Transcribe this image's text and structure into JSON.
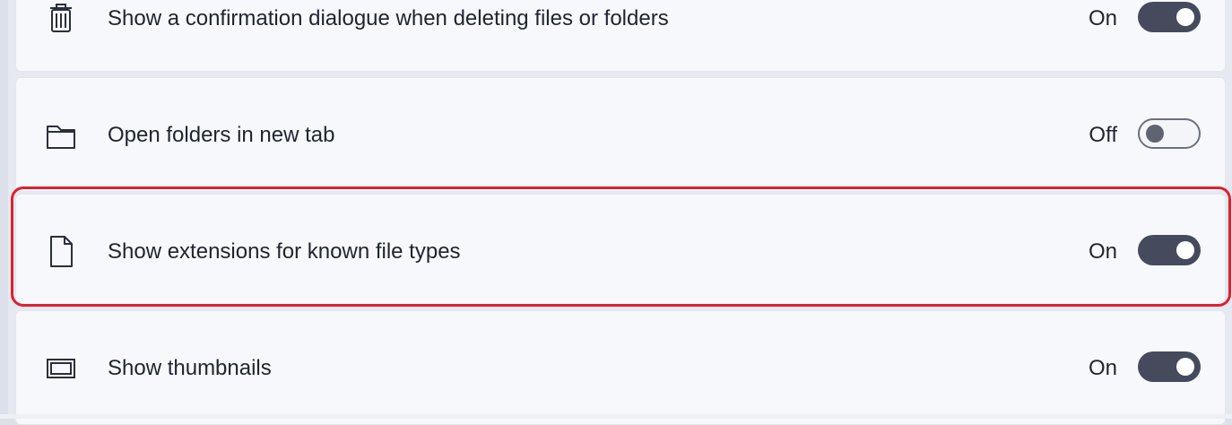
{
  "settings": [
    {
      "label": "Show a confirmation dialogue when deleting files or folders",
      "state": "On",
      "icon": "trash-icon",
      "enabled": true
    },
    {
      "label": "Open folders in new tab",
      "state": "Off",
      "icon": "folder-icon",
      "enabled": false
    },
    {
      "label": "Show extensions for known file types",
      "state": "On",
      "icon": "file-icon",
      "enabled": true
    },
    {
      "label": "Show thumbnails",
      "state": "On",
      "icon": "thumbnail-icon",
      "enabled": true
    }
  ],
  "colors": {
    "highlight": "#df1f2f",
    "toggle_on": "#454b5d",
    "toggle_off_border": "#6b7080",
    "card_bg": "#f7f8fb",
    "text": "#1f2430"
  }
}
